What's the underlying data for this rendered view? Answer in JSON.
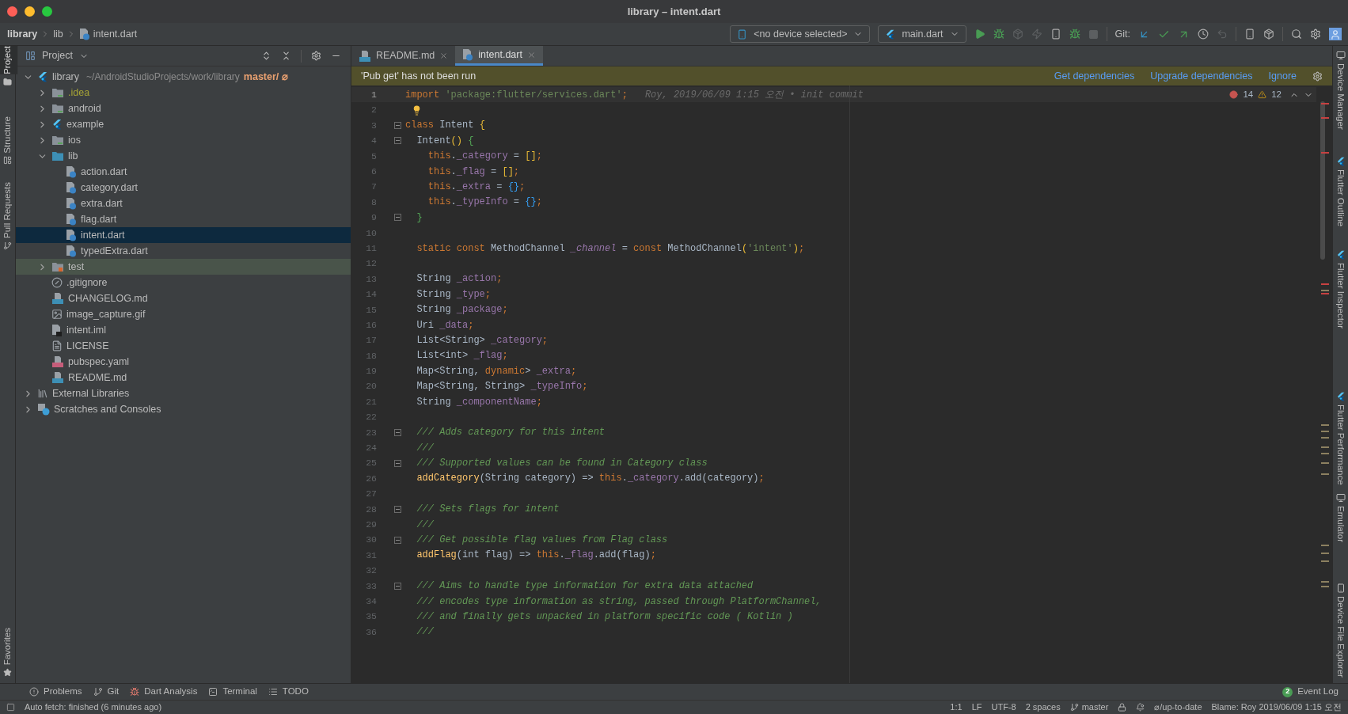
{
  "window": {
    "title": "library – intent.dart"
  },
  "breadcrumbs": [
    {
      "label": "library",
      "bold": true
    },
    {
      "label": "lib",
      "bold": false
    },
    {
      "label": "intent.dart",
      "bold": false
    }
  ],
  "toolbar": {
    "device": "<no device selected>",
    "run_config": "main.dart",
    "git_label": "Git:"
  },
  "left_strip": [
    {
      "label": "Project",
      "selected": true
    },
    {
      "label": "Structure",
      "selected": false
    },
    {
      "label": "Pull Requests",
      "selected": false
    },
    {
      "label": "Favorites",
      "selected": false
    }
  ],
  "project_panel": {
    "title": "Project",
    "tree": [
      {
        "label": "library",
        "kind": "flutter",
        "path": "~/AndroidStudioProjects/work/library",
        "branch": "master/ ⌀",
        "expanded": true,
        "selected": false,
        "highlighted": false,
        "ignored": false,
        "children": [
          {
            "label": ".idea",
            "kind": "idea-folder",
            "expanded": false,
            "selected": false,
            "highlighted": false,
            "ignored": true
          },
          {
            "label": "android",
            "kind": "platform-folder",
            "expanded": false,
            "selected": false,
            "highlighted": false,
            "ignored": false
          },
          {
            "label": "example",
            "kind": "flutter",
            "expanded": false,
            "selected": false,
            "highlighted": false,
            "ignored": false
          },
          {
            "label": "ios",
            "kind": "platform-folder",
            "expanded": false,
            "selected": false,
            "highlighted": false,
            "ignored": false
          },
          {
            "label": "lib",
            "kind": "source-folder",
            "expanded": true,
            "selected": false,
            "highlighted": false,
            "ignored": false,
            "children": [
              {
                "label": "action.dart",
                "kind": "dart",
                "selected": false,
                "highlighted": false,
                "ignored": false
              },
              {
                "label": "category.dart",
                "kind": "dart",
                "selected": false,
                "highlighted": false,
                "ignored": false
              },
              {
                "label": "extra.dart",
                "kind": "dart",
                "selected": false,
                "highlighted": false,
                "ignored": false
              },
              {
                "label": "flag.dart",
                "kind": "dart",
                "selected": false,
                "highlighted": false,
                "ignored": false
              },
              {
                "label": "intent.dart",
                "kind": "dart",
                "selected": true,
                "highlighted": false,
                "ignored": false
              },
              {
                "label": "typedExtra.dart",
                "kind": "dart",
                "selected": false,
                "highlighted": false,
                "ignored": false
              }
            ]
          },
          {
            "label": "test",
            "kind": "test-folder",
            "expanded": false,
            "selected": false,
            "highlighted": true,
            "ignored": false
          },
          {
            "label": ".gitignore",
            "kind": "gitignore",
            "selected": false,
            "highlighted": false,
            "ignored": false
          },
          {
            "label": "CHANGELOG.md",
            "kind": "md",
            "selected": false,
            "highlighted": false,
            "ignored": false
          },
          {
            "label": "image_capture.gif",
            "kind": "image",
            "selected": false,
            "highlighted": false,
            "ignored": false
          },
          {
            "label": "intent.iml",
            "kind": "iml",
            "selected": false,
            "highlighted": false,
            "ignored": false
          },
          {
            "label": "LICENSE",
            "kind": "text",
            "selected": false,
            "highlighted": false,
            "ignored": false
          },
          {
            "label": "pubspec.yaml",
            "kind": "yaml",
            "selected": false,
            "highlighted": false,
            "ignored": false
          },
          {
            "label": "README.md",
            "kind": "md",
            "selected": false,
            "highlighted": false,
            "ignored": false
          }
        ]
      },
      {
        "label": "External Libraries",
        "kind": "libraries",
        "expanded": false,
        "selected": false,
        "highlighted": false,
        "ignored": false
      },
      {
        "label": "Scratches and Consoles",
        "kind": "scratches",
        "expanded": false,
        "selected": false,
        "highlighted": false,
        "ignored": false
      }
    ]
  },
  "editor_tabs": [
    {
      "label": "README.md",
      "kind": "md",
      "selected": false
    },
    {
      "label": "intent.dart",
      "kind": "dart",
      "selected": true
    }
  ],
  "banner": {
    "message": "'Pub get' has not been run",
    "actions": [
      "Get dependencies",
      "Upgrade dependencies",
      "Ignore"
    ]
  },
  "inspections": {
    "errors": "14",
    "warnings": "12"
  },
  "code_lines": [
    {
      "n": "1",
      "fold": false,
      "current": true,
      "blame": "Roy, 2019/06/09 1:15 오전 • init commit",
      "tokens": [
        {
          "kind": "kw",
          "text": "import "
        },
        {
          "kind": "str",
          "text": "'package:flutter/services.dart'"
        },
        {
          "kind": "kw",
          "text": ";"
        }
      ]
    },
    {
      "n": "2",
      "fold": false,
      "current": false,
      "bulb": true
    },
    {
      "n": "3",
      "fold": true,
      "current": false,
      "tokens": [
        {
          "kind": "kw",
          "text": "class "
        },
        {
          "kind": "plain",
          "text": "Intent "
        },
        {
          "kind": "b1",
          "text": "{"
        }
      ]
    },
    {
      "n": "4",
      "fold": true,
      "current": false,
      "tokens": [
        {
          "kind": "plain",
          "text": "  Intent"
        },
        {
          "kind": "b1",
          "text": "()"
        },
        {
          "kind": "b2",
          "text": " {"
        }
      ]
    },
    {
      "n": "5",
      "fold": false,
      "current": false,
      "tokens": [
        {
          "kind": "kw",
          "text": "    this"
        },
        {
          "kind": "plain",
          "text": "."
        },
        {
          "kind": "field",
          "text": "_category"
        },
        {
          "kind": "plain",
          "text": " = "
        },
        {
          "kind": "b1",
          "text": "[]"
        },
        {
          "kind": "kw",
          "text": ";"
        }
      ]
    },
    {
      "n": "6",
      "fold": false,
      "current": false,
      "tokens": [
        {
          "kind": "kw",
          "text": "    this"
        },
        {
          "kind": "plain",
          "text": "."
        },
        {
          "kind": "field",
          "text": "_flag"
        },
        {
          "kind": "plain",
          "text": " = "
        },
        {
          "kind": "b1",
          "text": "[]"
        },
        {
          "kind": "kw",
          "text": ";"
        }
      ]
    },
    {
      "n": "7",
      "fold": false,
      "current": false,
      "tokens": [
        {
          "kind": "kw",
          "text": "    this"
        },
        {
          "kind": "plain",
          "text": "."
        },
        {
          "kind": "field",
          "text": "_extra"
        },
        {
          "kind": "plain",
          "text": " = "
        },
        {
          "kind": "b3",
          "text": "{}"
        },
        {
          "kind": "kw",
          "text": ";"
        }
      ]
    },
    {
      "n": "8",
      "fold": false,
      "current": false,
      "tokens": [
        {
          "kind": "kw",
          "text": "    this"
        },
        {
          "kind": "plain",
          "text": "."
        },
        {
          "kind": "field",
          "text": "_typeInfo"
        },
        {
          "kind": "plain",
          "text": " = "
        },
        {
          "kind": "b3",
          "text": "{}"
        },
        {
          "kind": "kw",
          "text": ";"
        }
      ]
    },
    {
      "n": "9",
      "fold": true,
      "current": false,
      "tokens": [
        {
          "kind": "b2",
          "text": "  }"
        }
      ]
    },
    {
      "n": "10",
      "fold": false,
      "current": false
    },
    {
      "n": "11",
      "fold": false,
      "current": false,
      "tokens": [
        {
          "kind": "kw",
          "text": "  static const "
        },
        {
          "kind": "plain",
          "text": "MethodChannel "
        },
        {
          "kind": "field-italic",
          "text": "_channel"
        },
        {
          "kind": "plain",
          "text": " = "
        },
        {
          "kind": "kw",
          "text": "const "
        },
        {
          "kind": "plain",
          "text": "MethodChannel"
        },
        {
          "kind": "b1",
          "text": "("
        },
        {
          "kind": "str",
          "text": "'intent'"
        },
        {
          "kind": "b1",
          "text": ")"
        },
        {
          "kind": "kw",
          "text": ";"
        }
      ]
    },
    {
      "n": "12",
      "fold": false,
      "current": false
    },
    {
      "n": "13",
      "fold": false,
      "current": false,
      "tokens": [
        {
          "kind": "plain",
          "text": "  String "
        },
        {
          "kind": "field",
          "text": "_action"
        },
        {
          "kind": "kw",
          "text": ";"
        }
      ]
    },
    {
      "n": "14",
      "fold": false,
      "current": false,
      "tokens": [
        {
          "kind": "plain",
          "text": "  String "
        },
        {
          "kind": "field",
          "text": "_type"
        },
        {
          "kind": "kw",
          "text": ";"
        }
      ]
    },
    {
      "n": "15",
      "fold": false,
      "current": false,
      "tokens": [
        {
          "kind": "plain",
          "text": "  String "
        },
        {
          "kind": "field",
          "text": "_package"
        },
        {
          "kind": "kw",
          "text": ";"
        }
      ]
    },
    {
      "n": "16",
      "fold": false,
      "current": false,
      "tokens": [
        {
          "kind": "plain",
          "text": "  Uri "
        },
        {
          "kind": "field",
          "text": "_data"
        },
        {
          "kind": "kw",
          "text": ";"
        }
      ]
    },
    {
      "n": "17",
      "fold": false,
      "current": false,
      "tokens": [
        {
          "kind": "plain",
          "text": "  List<String> "
        },
        {
          "kind": "field",
          "text": "_category"
        },
        {
          "kind": "kw",
          "text": ";"
        }
      ]
    },
    {
      "n": "18",
      "fold": false,
      "current": false,
      "tokens": [
        {
          "kind": "plain",
          "text": "  List<int> "
        },
        {
          "kind": "field",
          "text": "_flag"
        },
        {
          "kind": "kw",
          "text": ";"
        }
      ]
    },
    {
      "n": "19",
      "fold": false,
      "current": false,
      "tokens": [
        {
          "kind": "plain",
          "text": "  Map<String, "
        },
        {
          "kind": "kw",
          "text": "dynamic"
        },
        {
          "kind": "plain",
          "text": "> "
        },
        {
          "kind": "field",
          "text": "_extra"
        },
        {
          "kind": "kw",
          "text": ";"
        }
      ]
    },
    {
      "n": "20",
      "fold": false,
      "current": false,
      "tokens": [
        {
          "kind": "plain",
          "text": "  Map<String, String> "
        },
        {
          "kind": "field",
          "text": "_typeInfo"
        },
        {
          "kind": "kw",
          "text": ";"
        }
      ]
    },
    {
      "n": "21",
      "fold": false,
      "current": false,
      "tokens": [
        {
          "kind": "plain",
          "text": "  String "
        },
        {
          "kind": "field",
          "text": "_componentName"
        },
        {
          "kind": "kw",
          "text": ";"
        }
      ]
    },
    {
      "n": "22",
      "fold": false,
      "current": false
    },
    {
      "n": "23",
      "fold": true,
      "current": false,
      "tokens": [
        {
          "kind": "com",
          "text": "  /// Adds category for this intent"
        }
      ]
    },
    {
      "n": "24",
      "fold": false,
      "current": false,
      "tokens": [
        {
          "kind": "com",
          "text": "  ///"
        }
      ]
    },
    {
      "n": "25",
      "fold": true,
      "current": false,
      "tokens": [
        {
          "kind": "com",
          "text": "  /// Supported values can be found in Category class"
        }
      ]
    },
    {
      "n": "26",
      "fold": false,
      "current": false,
      "tokens": [
        {
          "kind": "fn",
          "text": "  addCategory"
        },
        {
          "kind": "plain",
          "text": "(String category) => "
        },
        {
          "kind": "kw",
          "text": "this"
        },
        {
          "kind": "plain",
          "text": "."
        },
        {
          "kind": "field",
          "text": "_category"
        },
        {
          "kind": "plain",
          "text": ".add(category)"
        },
        {
          "kind": "kw",
          "text": ";"
        }
      ]
    },
    {
      "n": "27",
      "fold": false,
      "current": false
    },
    {
      "n": "28",
      "fold": true,
      "current": false,
      "tokens": [
        {
          "kind": "com",
          "text": "  /// Sets flags for intent"
        }
      ]
    },
    {
      "n": "29",
      "fold": false,
      "current": false,
      "tokens": [
        {
          "kind": "com",
          "text": "  ///"
        }
      ]
    },
    {
      "n": "30",
      "fold": true,
      "current": false,
      "tokens": [
        {
          "kind": "com",
          "text": "  /// Get possible flag values from Flag class"
        }
      ]
    },
    {
      "n": "31",
      "fold": false,
      "current": false,
      "tokens": [
        {
          "kind": "fn",
          "text": "  addFlag"
        },
        {
          "kind": "plain",
          "text": "(int flag) => "
        },
        {
          "kind": "kw",
          "text": "this"
        },
        {
          "kind": "plain",
          "text": "."
        },
        {
          "kind": "field",
          "text": "_flag"
        },
        {
          "kind": "plain",
          "text": ".add(flag)"
        },
        {
          "kind": "kw",
          "text": ";"
        }
      ]
    },
    {
      "n": "32",
      "fold": false,
      "current": false
    },
    {
      "n": "33",
      "fold": true,
      "current": false,
      "tokens": [
        {
          "kind": "com",
          "text": "  /// Aims to handle type information for extra data attached"
        }
      ]
    },
    {
      "n": "34",
      "fold": false,
      "current": false,
      "tokens": [
        {
          "kind": "com",
          "text": "  /// encodes type information as string, passed through PlatformChannel,"
        }
      ]
    },
    {
      "n": "35",
      "fold": false,
      "current": false,
      "tokens": [
        {
          "kind": "com",
          "text": "  /// and finally gets unpacked in platform specific code ( Kotlin )"
        }
      ]
    },
    {
      "n": "36",
      "fold": false,
      "current": false,
      "tokens": [
        {
          "kind": "com",
          "text": "  ///"
        }
      ]
    }
  ],
  "right_strip": [
    {
      "label": "Device Manager",
      "kind": "device"
    },
    {
      "label": "Flutter Outline",
      "kind": "flutter"
    },
    {
      "label": "Flutter Inspector",
      "kind": "flutter"
    },
    {
      "label": "Flutter Performance",
      "kind": "flutter"
    },
    {
      "label": "Emulator",
      "kind": "device"
    },
    {
      "label": "Device File Explorer",
      "kind": "phone"
    }
  ],
  "bottom_tools": [
    {
      "label": "Problems",
      "kind": "problems"
    },
    {
      "label": "Git",
      "kind": "git"
    },
    {
      "label": "Dart Analysis",
      "kind": "dart"
    },
    {
      "label": "Terminal",
      "kind": "terminal"
    },
    {
      "label": "TODO",
      "kind": "todo"
    }
  ],
  "event_log": {
    "label": "Event Log",
    "count": "2"
  },
  "status_bar": {
    "message": "Auto fetch: finished (6 minutes ago)",
    "position": "1:1",
    "line_separator": "LF",
    "encoding": "UTF-8",
    "indent": "2 spaces",
    "branch": "master",
    "vcs_status": "⌀/up-to-date",
    "blame": "Blame: Roy 2019/06/09 1:15 오전"
  }
}
